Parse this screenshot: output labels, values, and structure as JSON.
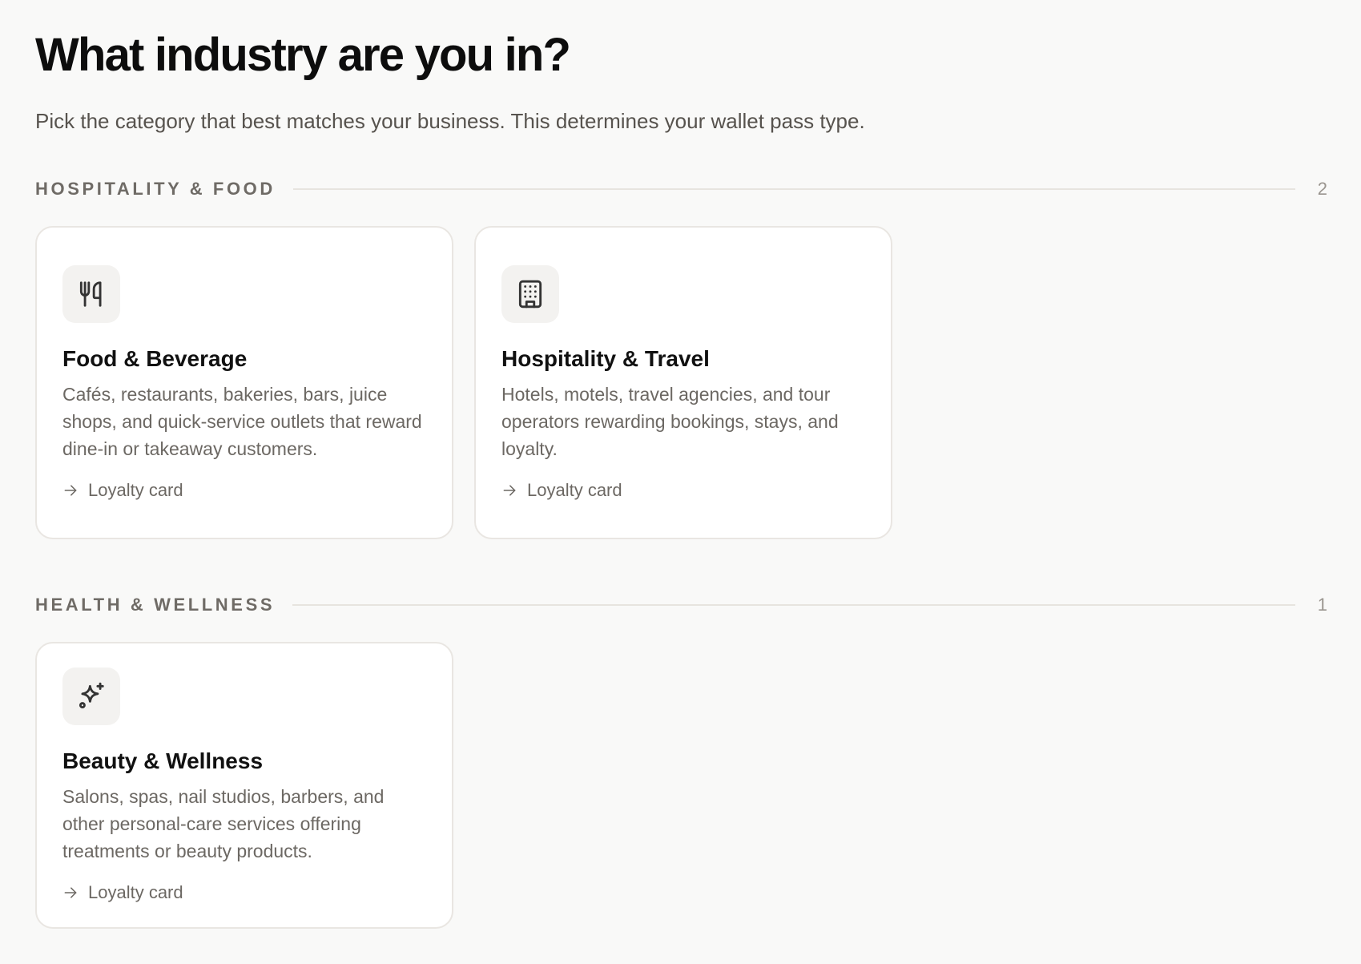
{
  "header": {
    "title": "What industry are you in?",
    "subtitle": "Pick the category that best matches your business. This determines your wallet pass type."
  },
  "sections": [
    {
      "title": "HOSPITALITY & FOOD",
      "count": "2",
      "cards": [
        {
          "icon": "fork-knife-icon",
          "title": "Food & Beverage",
          "description": "Cafés, restaurants, bakeries, bars, juice shops, and quick-service outlets that reward dine-in or takeaway customers.",
          "pass_type": "Loyalty card"
        },
        {
          "icon": "building-icon",
          "title": "Hospitality & Travel",
          "description": "Hotels, motels, travel agencies, and tour operators rewarding bookings, stays, and loyalty.",
          "pass_type": "Loyalty card"
        }
      ]
    },
    {
      "title": "HEALTH & WELLNESS",
      "count": "1",
      "cards": [
        {
          "icon": "sparkles-icon",
          "title": "Beauty & Wellness",
          "description": "Salons, spas, nail studios, barbers, and other personal-care services offering treatments or beauty products.",
          "pass_type": "Loyalty card"
        }
      ]
    }
  ],
  "colors": {
    "background": "#f9f9f8",
    "card": "#ffffff",
    "muted_text": "#6c6863",
    "border": "#e9e6e2"
  }
}
